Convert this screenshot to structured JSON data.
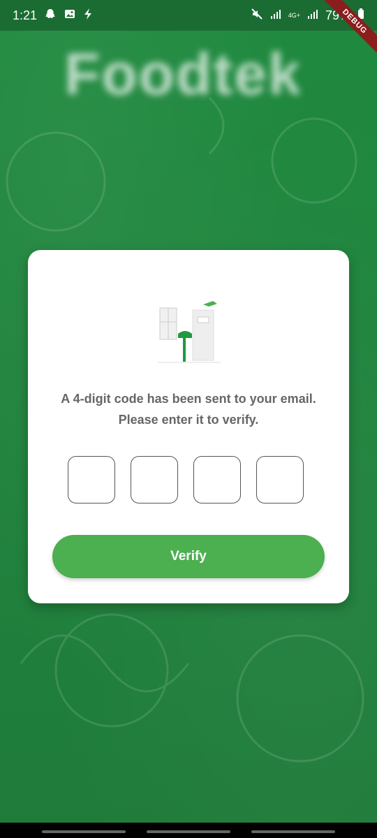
{
  "status_bar": {
    "time": "1:21",
    "battery": "79%",
    "network_badge": "4G+",
    "icons": [
      "snapchat-icon",
      "image-icon",
      "flash-icon",
      "mute-icon",
      "signal-icon",
      "signal-icon-2",
      "battery-icon"
    ]
  },
  "debug_banner": "DEBUG",
  "brand": {
    "title": "Foodtek"
  },
  "verify_card": {
    "illustration": "mailbox-illustration",
    "message": "A 4-digit code has been sent to your email. Please enter it to verify.",
    "otp_digits": [
      "",
      "",
      "",
      ""
    ],
    "button_label": "Verify"
  },
  "colors": {
    "background": "#1f7d3b",
    "accent": "#4caf50",
    "card": "#ffffff"
  }
}
